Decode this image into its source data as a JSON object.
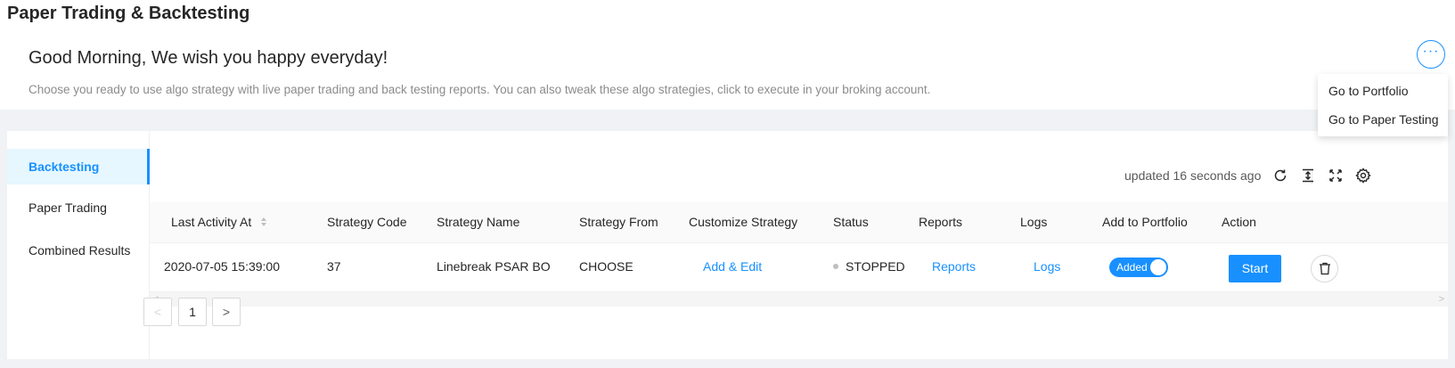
{
  "page": {
    "title": "Paper Trading & Backtesting"
  },
  "header": {
    "greeting": "Good Morning, We wish you happy everyday!",
    "subtext": "Choose you ready to use algo strategy with live paper trading and back testing reports. You can also tweak these algo strategies, click to execute in your broking account.",
    "more_label": "···"
  },
  "dropdown": {
    "items": [
      {
        "label": "Go to Portfolio"
      },
      {
        "label": "Go to Paper Testing"
      }
    ]
  },
  "sidebar": {
    "items": [
      {
        "label": "Backtesting",
        "active": true
      },
      {
        "label": "Paper Trading",
        "active": false
      },
      {
        "label": "Combined Results",
        "active": false
      }
    ]
  },
  "toolbar": {
    "updated_text": "updated 16 seconds ago",
    "icons": [
      "reload-icon",
      "column-height-icon",
      "fullscreen-icon",
      "setting-icon"
    ]
  },
  "table": {
    "columns": [
      "Last Activity At",
      "Strategy Code",
      "Strategy Name",
      "Strategy From",
      "Customize Strategy",
      "Status",
      "Reports",
      "Logs",
      "Add to Portfolio",
      "Action"
    ],
    "rows": [
      {
        "last_activity": "2020-07-05 15:39:00",
        "strategy_code": "37",
        "strategy_name": "Linebreak PSAR BO",
        "strategy_from": "CHOOSE",
        "customize": "Add & Edit",
        "status": "STOPPED",
        "reports": "Reports",
        "logs": "Logs",
        "portfolio_toggle": "Added",
        "action": "Start"
      }
    ]
  },
  "pagination": {
    "prev": "<",
    "current": "1",
    "next": ">"
  },
  "scroll": {
    "left": "<",
    "right": ">"
  },
  "colors": {
    "primary": "#1890ff",
    "background": "#f0f2f5",
    "status_dot": "#bfbfbf"
  }
}
